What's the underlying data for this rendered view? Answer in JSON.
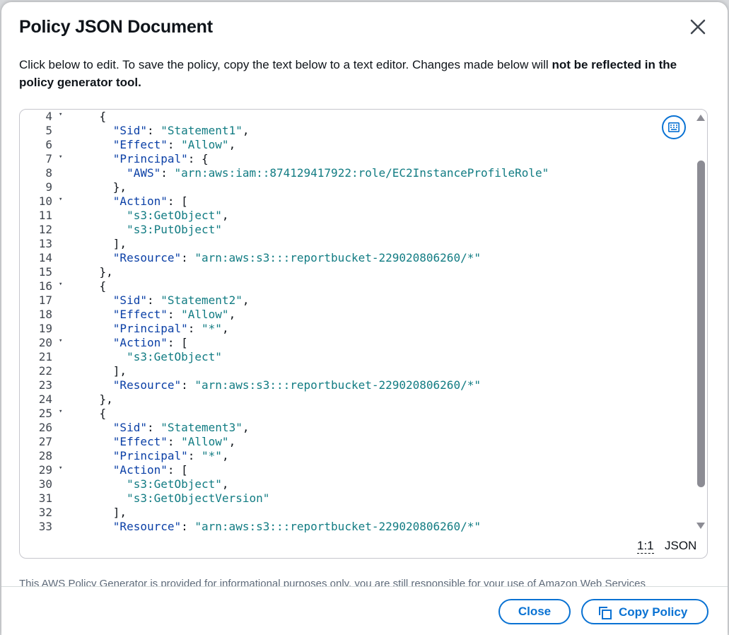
{
  "dialog": {
    "title": "Policy JSON Document",
    "description_prefix": "Click below to edit. To save the policy, copy the text below to a text editor. Changes made below will ",
    "description_bold": "not be reflected in the policy generator tool.",
    "disclaimer": "This AWS Policy Generator is provided for informational purposes only, you are still responsible for your use of Amazon Web Services"
  },
  "editor": {
    "cursor_position": "1:1",
    "language": "JSON",
    "lines": [
      {
        "n": "4",
        "fold": true,
        "text": "    {"
      },
      {
        "n": "5",
        "fold": false,
        "text": "      \"Sid\": \"Statement1\","
      },
      {
        "n": "6",
        "fold": false,
        "text": "      \"Effect\": \"Allow\","
      },
      {
        "n": "7",
        "fold": true,
        "text": "      \"Principal\": {"
      },
      {
        "n": "8",
        "fold": false,
        "text": "        \"AWS\": \"arn:aws:iam::874129417922:role/EC2InstanceProfileRole\""
      },
      {
        "n": "9",
        "fold": false,
        "text": "      },"
      },
      {
        "n": "10",
        "fold": true,
        "text": "      \"Action\": ["
      },
      {
        "n": "11",
        "fold": false,
        "text": "        \"s3:GetObject\","
      },
      {
        "n": "12",
        "fold": false,
        "text": "        \"s3:PutObject\""
      },
      {
        "n": "13",
        "fold": false,
        "text": "      ],"
      },
      {
        "n": "14",
        "fold": false,
        "text": "      \"Resource\": \"arn:aws:s3:::reportbucket-229020806260/*\""
      },
      {
        "n": "15",
        "fold": false,
        "text": "    },"
      },
      {
        "n": "16",
        "fold": true,
        "text": "    {"
      },
      {
        "n": "17",
        "fold": false,
        "text": "      \"Sid\": \"Statement2\","
      },
      {
        "n": "18",
        "fold": false,
        "text": "      \"Effect\": \"Allow\","
      },
      {
        "n": "19",
        "fold": false,
        "text": "      \"Principal\": \"*\","
      },
      {
        "n": "20",
        "fold": true,
        "text": "      \"Action\": ["
      },
      {
        "n": "21",
        "fold": false,
        "text": "        \"s3:GetObject\""
      },
      {
        "n": "22",
        "fold": false,
        "text": "      ],"
      },
      {
        "n": "23",
        "fold": false,
        "text": "      \"Resource\": \"arn:aws:s3:::reportbucket-229020806260/*\""
      },
      {
        "n": "24",
        "fold": false,
        "text": "    },"
      },
      {
        "n": "25",
        "fold": true,
        "text": "    {"
      },
      {
        "n": "26",
        "fold": false,
        "text": "      \"Sid\": \"Statement3\","
      },
      {
        "n": "27",
        "fold": false,
        "text": "      \"Effect\": \"Allow\","
      },
      {
        "n": "28",
        "fold": false,
        "text": "      \"Principal\": \"*\","
      },
      {
        "n": "29",
        "fold": true,
        "text": "      \"Action\": ["
      },
      {
        "n": "30",
        "fold": false,
        "text": "        \"s3:GetObject\","
      },
      {
        "n": "31",
        "fold": false,
        "text": "        \"s3:GetObjectVersion\""
      },
      {
        "n": "32",
        "fold": false,
        "text": "      ],"
      },
      {
        "n": "33",
        "fold": false,
        "text": "      \"Resource\": \"arn:aws:s3:::reportbucket-229020806260/*\""
      }
    ]
  },
  "footer": {
    "close_label": "Close",
    "copy_label": "Copy Policy"
  },
  "colors": {
    "accent": "#0972d3",
    "json_key": "#0a3fa6",
    "json_string": "#127c83"
  },
  "icons": {
    "close": "close-icon",
    "keyboard": "keyboard-icon",
    "copy": "copy-icon",
    "fold": "fold-arrow-icon"
  }
}
